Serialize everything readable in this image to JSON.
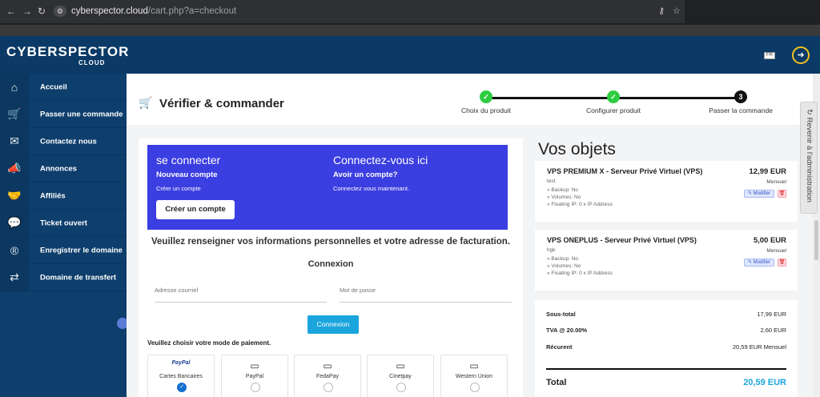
{
  "browser": {
    "url_host": "cyberspector.cloud",
    "url_path": "/cart.php?a=checkout"
  },
  "header": {
    "logo_text": "CYBERSPECTOR",
    "logo_sub": "CLOUD",
    "lang_flag": "FR"
  },
  "sidebar": {
    "items": [
      {
        "label": "Accueil",
        "icon": "home-icon",
        "glyph": "⌂"
      },
      {
        "label": "Passer une commande",
        "icon": "cart-icon",
        "glyph": "🛒"
      },
      {
        "label": "Contactez nous",
        "icon": "mail-icon",
        "glyph": "✉"
      },
      {
        "label": "Annonces",
        "icon": "megaphone-icon",
        "glyph": "📣"
      },
      {
        "label": "Affiliés",
        "icon": "handshake-icon",
        "glyph": "🤝"
      },
      {
        "label": "Ticket ouvert",
        "icon": "chat-icon",
        "glyph": "💬"
      },
      {
        "label": "Enregistrer le domaine",
        "icon": "registered-icon",
        "glyph": "®"
      },
      {
        "label": "Domaine de transfert",
        "icon": "transfer-icon",
        "glyph": "⇄"
      }
    ]
  },
  "page": {
    "title": "Vérifier & commander"
  },
  "steps": [
    {
      "label": "Choix du produit",
      "state": "done",
      "mark": "✓"
    },
    {
      "label": "Configurer produit",
      "state": "done",
      "mark": "✓"
    },
    {
      "label": "Passer la commande",
      "state": "current",
      "mark": "3"
    }
  ],
  "login_box": {
    "left_title": "se connecter",
    "left_bold": "Nouveau compte",
    "left_small": "Créer un compte",
    "create_button": "Créer un compte",
    "right_title": "Connectez-vous ici",
    "right_bold": "Avoir un compte?",
    "right_small": "Connectez vous maintenant."
  },
  "form": {
    "fill_info": "Veuillez renseigner vos informations personnelles et votre adresse de facturation.",
    "connexion_heading": "Connexion",
    "email_placeholder": "Adresse courriel",
    "password_placeholder": "Mot de passe",
    "connexion_button": "Connexion"
  },
  "payment": {
    "title": "Veuillez choisir votre mode de paiement.",
    "methods": [
      {
        "label": "Cartes Bancaires",
        "brand": "PayPal",
        "checked": true
      },
      {
        "label": "PayPal",
        "checked": false
      },
      {
        "label": "FedaPay",
        "checked": false
      },
      {
        "label": "Cinetpay",
        "checked": false
      },
      {
        "label": "Western Union",
        "checked": false
      }
    ]
  },
  "cart": {
    "title": "Vos objets",
    "items": [
      {
        "name": "VPS PREMIUM X - Serveur Privé Virtuel (VPS)",
        "desc": "test",
        "details": [
          "» Backup: No",
          "» Volumes: No",
          "» Floating IP: 0 x IP Address"
        ],
        "price": "12,99 EUR",
        "cycle": "Mensuel",
        "edit_label": "Modifier"
      },
      {
        "name": "VPS ONEPLUS - Serveur Privé Virtuel (VPS)",
        "desc": "hgk",
        "details": [
          "» Backup: No",
          "» Volumes: No",
          "» Floating IP: 0 x IP Address"
        ],
        "price": "5,00 EUR",
        "cycle": "Mensuel",
        "edit_label": "Modifier"
      }
    ],
    "subtotal_label": "Sous-total",
    "subtotal_value": "17,99 EUR",
    "tax_label": "TVA @ 20.00%",
    "tax_value": "2,60 EUR",
    "recurring_label": "Récurent",
    "recurring_value": "20,59 EUR Mensuel",
    "total_label": "Total",
    "total_value": "20,59 EUR"
  },
  "admin_tab": {
    "label": "Revenir à l'administration"
  },
  "colors": {
    "header_bg": "#0b3a66",
    "login_box": "#3b3ee0",
    "accent": "#1aa5dd",
    "success": "#2ecc40"
  }
}
